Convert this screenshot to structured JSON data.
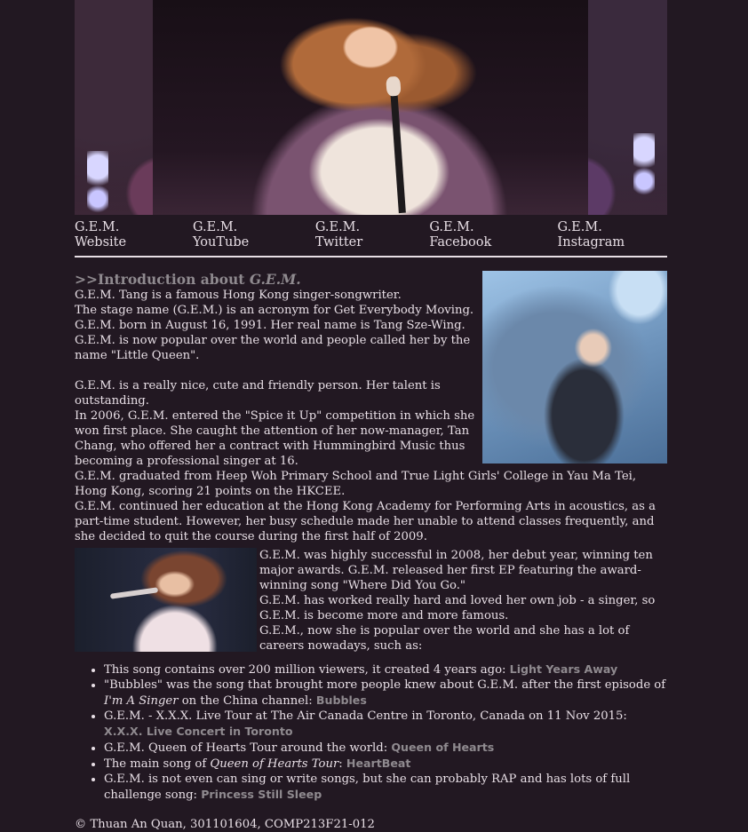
{
  "nav": [
    {
      "label": "G.E.M. Website"
    },
    {
      "label": "G.E.M. YouTube"
    },
    {
      "label": "G.E.M. Twitter"
    },
    {
      "label": "G.E.M. Facebook"
    },
    {
      "label": "G.E.M. Instagram"
    }
  ],
  "intro": {
    "prefix": ">>",
    "title": "Introduction about ",
    "name": "G.E.M."
  },
  "para1": [
    "G.E.M. Tang is a famous Hong Kong singer-songwriter.",
    "The stage name (G.E.M.) is an acronym for Get Everybody Moving.",
    "G.E.M. born in August 16, 1991. Her real name is Tang Sze-Wing.",
    "G.E.M. is now popular over the world and people called her by the name \"Little Queen\"."
  ],
  "para2": [
    "G.E.M. is a really nice, cute and friendly person. Her talent is outstanding.",
    "In 2006, G.E.M. entered the \"Spice it Up\" competition in which she won first place. She caught the attention of her now-manager, Tan Chang, who offered her a contract with Hummingbird Music thus becoming a professional singer at 16.",
    "G.E.M. graduated from Heep Woh Primary School and True Light Girls' College in Yau Ma Tei, Hong Kong, scoring 21 points on the HKCEE.",
    "G.E.M. continued her education at the Hong Kong Academy for Performing Arts in acoustics, as a part-time student. However, her busy schedule made her unable to attend classes frequently, and she decided to quit the course during the first half of 2009."
  ],
  "para3": [
    "G.E.M. was highly successful in 2008, her debut year, winning ten major awards. G.E.M. released her first EP featuring the award-winning song \"Where Did You Go.\"",
    "G.E.M. has worked really hard and loved her own job - a singer, so G.E.M. is become more and more famous.",
    "G.E.M., now she is popular over the world and she has a lot of careers nowadays, such as:"
  ],
  "list": [
    {
      "text": "This song contains over 200 million viewers, it created 4 years ago: ",
      "link": "Light Years Away"
    },
    {
      "text_a": "\"Bubbles\" was the song that brought more people knew about G.E.M. after the first episode of ",
      "em": "I'm A Singer",
      "text_b": " on the China channel: ",
      "link": "Bubbles"
    },
    {
      "text": "G.E.M. - X.X.X. Live Tour at The Air Canada Centre in Toronto, Canada on 11 Nov 2015: ",
      "link": "X.X.X. Live Concert in Toronto"
    },
    {
      "text": "G.E.M. Queen of Hearts Tour around the world: ",
      "link": "Queen of Hearts"
    },
    {
      "text_a": "The main song of ",
      "em": "Queen of Hearts Tour",
      "text_b": ": ",
      "link": "HeartBeat"
    },
    {
      "text": "G.E.M. is not even can sing or write songs, but she can probably RAP and has lots of full challenge song: ",
      "link": "Princess Still Sleep"
    }
  ],
  "footer": "© Thuan An Quan, 301101604, COMP213F21-012"
}
